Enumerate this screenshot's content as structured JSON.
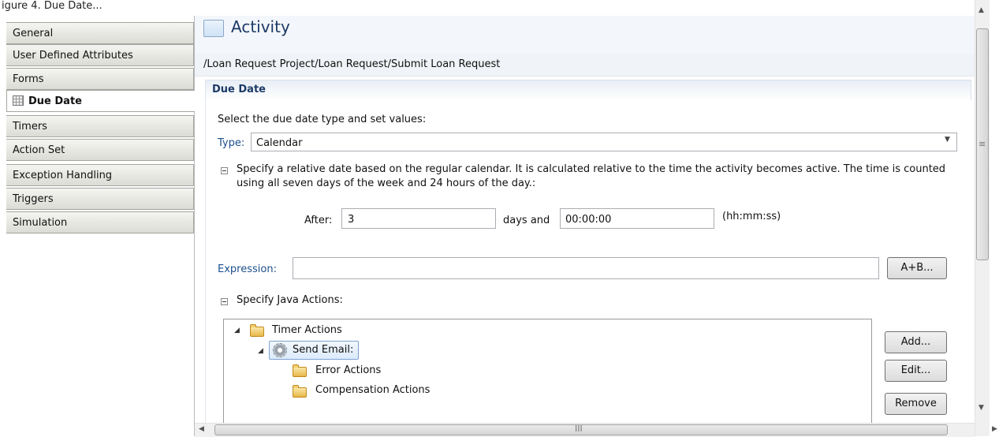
{
  "window": {
    "title": "igure 4. Due Date..."
  },
  "sidebar": {
    "items": [
      {
        "label": "General",
        "active": false
      },
      {
        "label": "User Defined Attributes",
        "active": false
      },
      {
        "label": "Forms",
        "active": false
      },
      {
        "label": "Due Date",
        "active": true,
        "icon": "calendar-icon"
      },
      {
        "label": "Timers",
        "active": false
      },
      {
        "label": "Action Set",
        "active": false
      },
      {
        "label": "Exception Handling",
        "active": false
      },
      {
        "label": "Triggers",
        "active": false
      },
      {
        "label": "Simulation",
        "active": false
      }
    ]
  },
  "header": {
    "title": "Activity",
    "path": "/Loan Request Project/Loan Request/Submit Loan Request"
  },
  "section": {
    "title": "Due Date",
    "instruction": "Select the due date type and set values:",
    "type_label": "Type:",
    "type_value": "Calendar",
    "description": "Specify a relative date based on the regular calendar. It is calculated relative to the time the activity becomes active. The time is counted using all seven days of the week and 24 hours of the day.:",
    "after_label": "After:",
    "after_value": "3",
    "days_label": "days and",
    "time_value": "00:00:00",
    "time_format": "(hh:mm:ss)",
    "expression_label": "Expression:",
    "expression_value": "",
    "expression_button": "A+B..."
  },
  "java_actions": {
    "label": "Specify Java Actions:",
    "tree": [
      {
        "label": "Timer Actions",
        "icon": "folder-icon",
        "expanded": true
      },
      {
        "label": "Send Email:",
        "icon": "gear-icon",
        "expanded": true,
        "selected": true
      },
      {
        "label": "Error Actions",
        "icon": "folder-icon"
      },
      {
        "label": "Compensation Actions",
        "icon": "folder-icon"
      }
    ],
    "buttons": {
      "add": "Add...",
      "edit": "Edit...",
      "remove": "Remove"
    }
  },
  "scrollbars": {
    "vertical_grip": "≡",
    "horizontal_grip": "III"
  },
  "colors": {
    "accent": "#1c3a66",
    "link_label": "#1c4f8c",
    "selection": "#dcebfc"
  }
}
